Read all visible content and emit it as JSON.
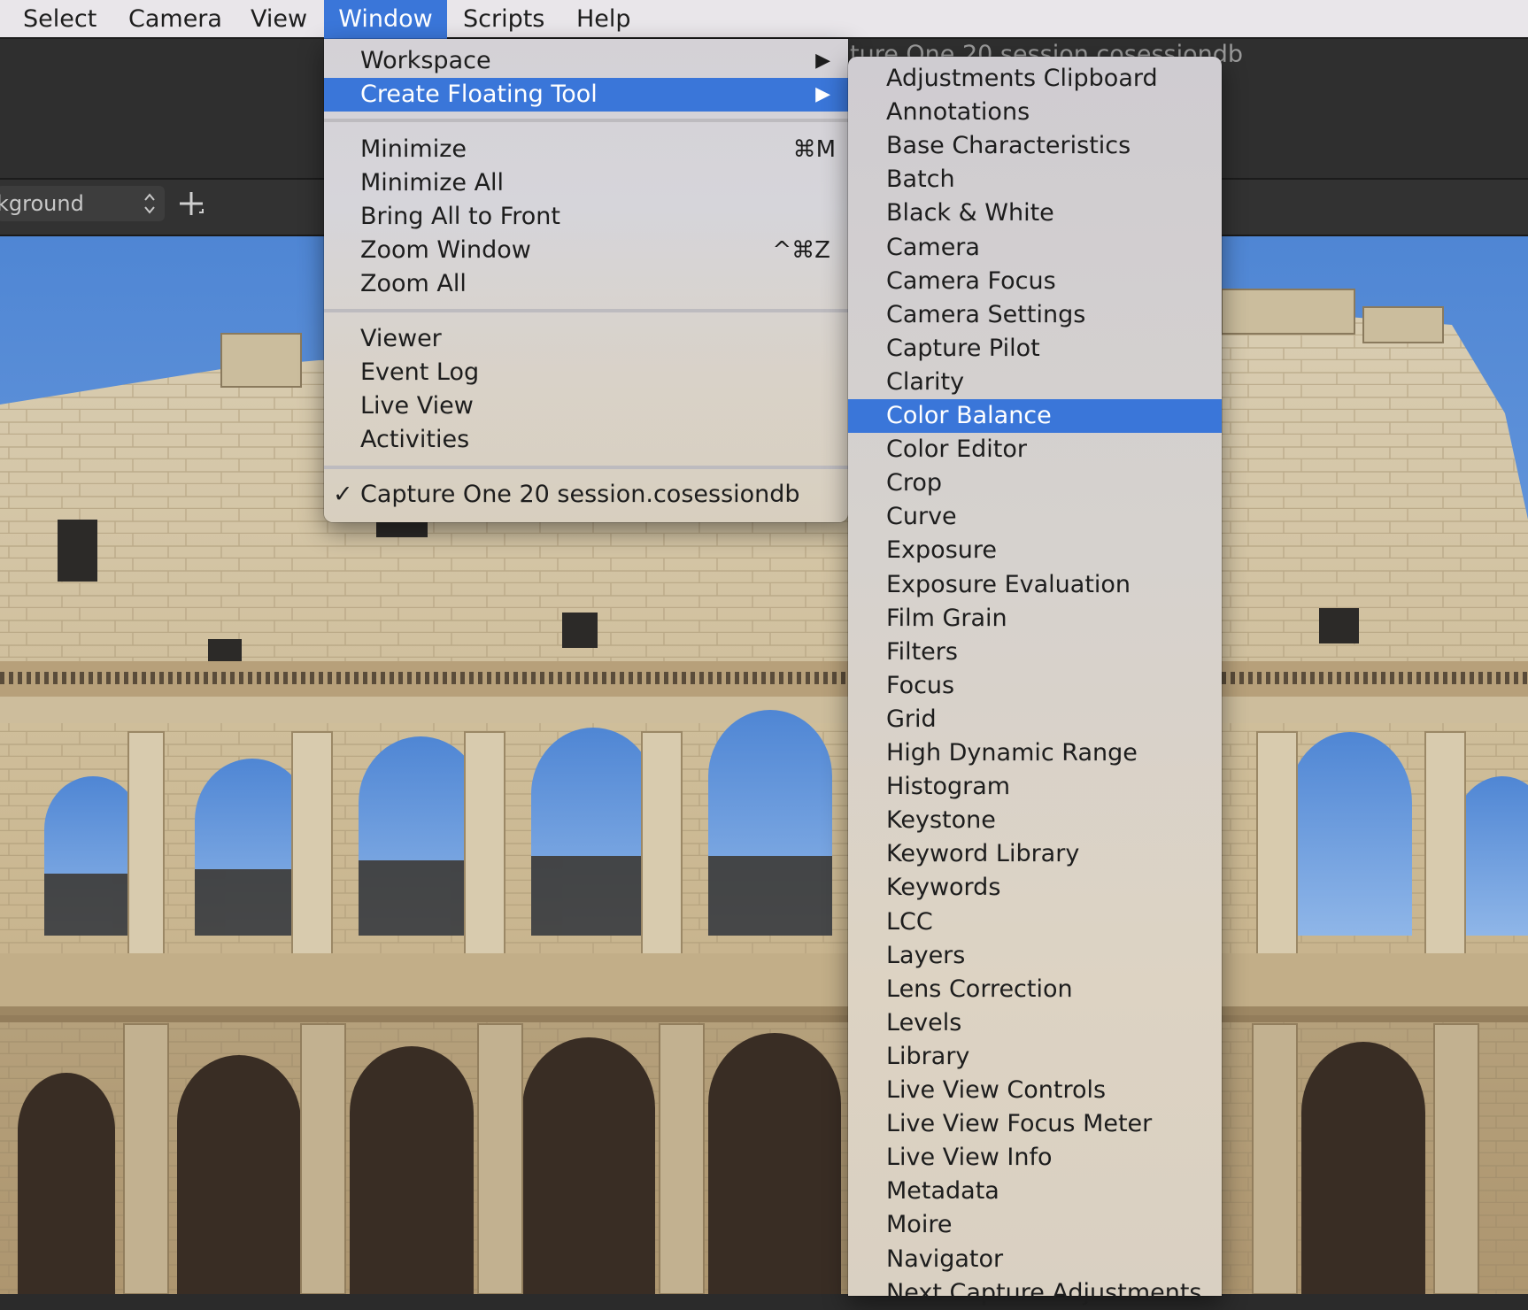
{
  "menubar": {
    "items": [
      {
        "label": "Select"
      },
      {
        "label": "Camera"
      },
      {
        "label": "View"
      },
      {
        "label": "Window"
      },
      {
        "label": "Scripts"
      },
      {
        "label": "Help"
      }
    ]
  },
  "app": {
    "window_title_partial": "ture One 20 session.cosessiondb",
    "background_select_value": "kground"
  },
  "window_menu": {
    "workspace": "Workspace",
    "create_floating_tool": "Create Floating Tool",
    "minimize": "Minimize",
    "minimize_shortcut": "⌘M",
    "minimize_all": "Minimize All",
    "bring_all_to_front": "Bring All to Front",
    "zoom_window": "Zoom Window",
    "zoom_window_shortcut": "^⌘Z",
    "zoom_all": "Zoom All",
    "viewer": "Viewer",
    "event_log": "Event Log",
    "live_view": "Live View",
    "activities": "Activities",
    "session": "Capture One 20 session.cosessiondb",
    "checkmark": "✓",
    "submenu_arrow": "▶"
  },
  "tool_submenu": {
    "highlighted": "Color Balance",
    "items": [
      "Adjustments Clipboard",
      "Annotations",
      "Base Characteristics",
      "Batch",
      "Black & White",
      "Camera",
      "Camera Focus",
      "Camera Settings",
      "Capture Pilot",
      "Clarity",
      "Color Balance",
      "Color Editor",
      "Crop",
      "Curve",
      "Exposure",
      "Exposure Evaluation",
      "Film Grain",
      "Filters",
      "Focus",
      "Grid",
      "High Dynamic Range",
      "Histogram",
      "Keystone",
      "Keyword Library",
      "Keywords",
      "LCC",
      "Layers",
      "Lens Correction",
      "Levels",
      "Library",
      "Live View Controls",
      "Live View Focus Meter",
      "Live View Info",
      "Metadata",
      "Moire",
      "Navigator",
      "Next Capture Adjustments"
    ]
  },
  "colors": {
    "highlight": "#3a76d9",
    "sky": "#5f93d8",
    "stone": "#d2c3a2"
  }
}
